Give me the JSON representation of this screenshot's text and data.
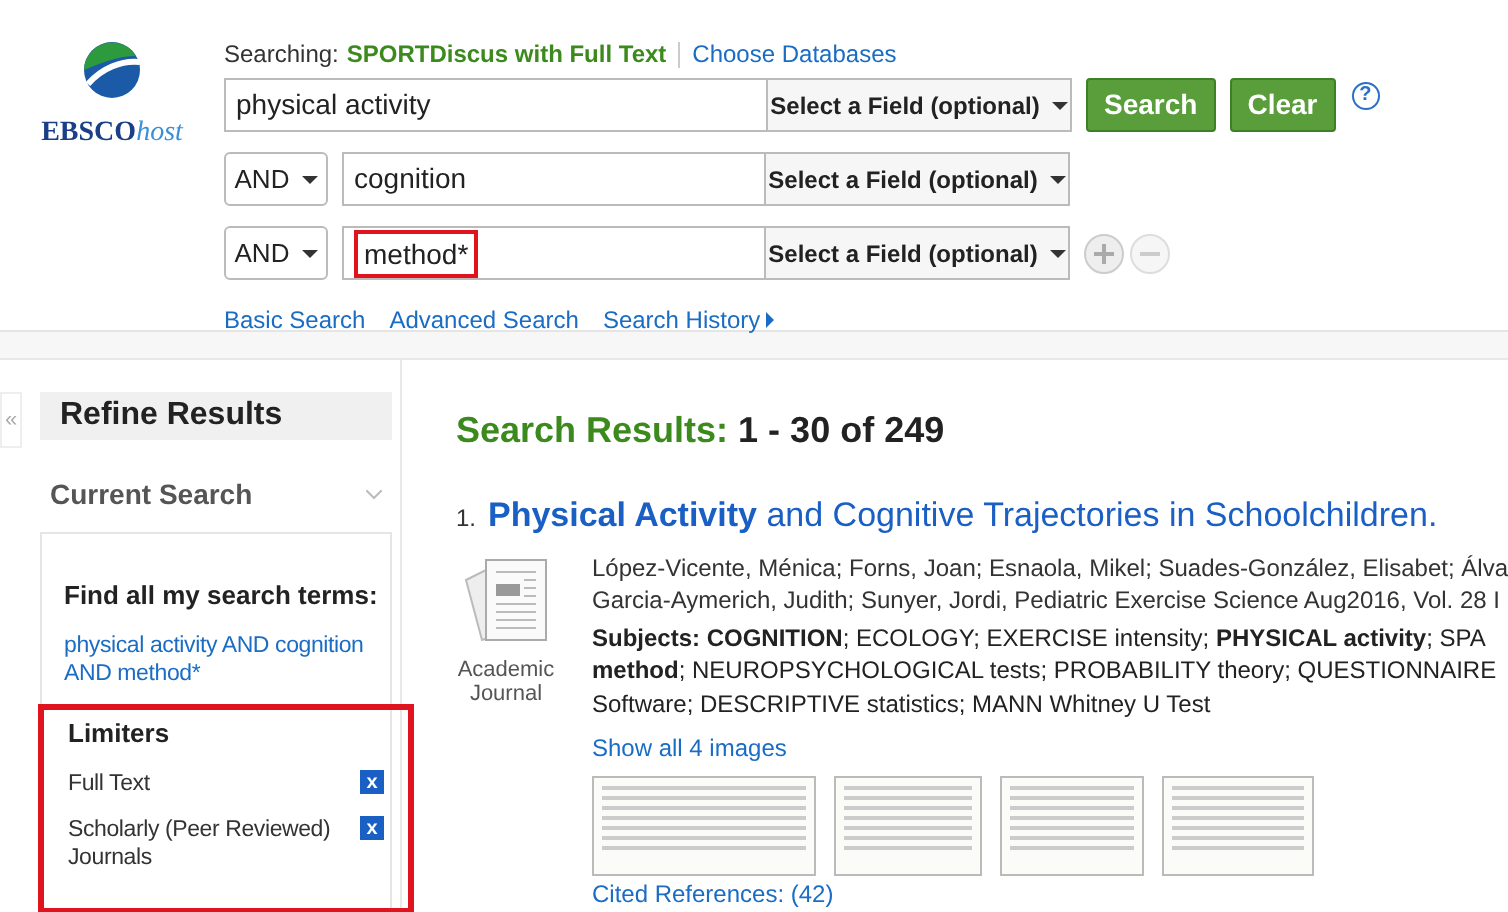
{
  "searching": {
    "label": "Searching:",
    "database": "SPORTDiscus with Full Text",
    "choose_link": "Choose Databases"
  },
  "logo": {
    "text": "EBSCO",
    "suffix": "host"
  },
  "search_rows": [
    {
      "operator": "",
      "value": "physical activity",
      "field": "Select a Field (optional)",
      "highlighted": false
    },
    {
      "operator": "AND",
      "value": "cognition",
      "field": "Select a Field (optional)",
      "highlighted": false
    },
    {
      "operator": "AND",
      "value": "method*",
      "field": "Select a Field (optional)",
      "highlighted": true
    }
  ],
  "buttons": [
    "Search",
    "Clear"
  ],
  "help": "?",
  "links": [
    "Basic Search",
    "Advanced Search",
    "Search History"
  ],
  "collapse": "«",
  "sidebar": {
    "title": "Refine Results",
    "current_search": "Current Search",
    "find_label": "Find all my search terms:",
    "query": "physical activity AND cognition AND method*",
    "limiters": {
      "title": "Limiters",
      "highlighted": true,
      "items": [
        {
          "label": "Full Text",
          "remove": "x"
        },
        {
          "label": "Scholarly (Peer Reviewed) Journals",
          "remove": "x"
        }
      ]
    }
  },
  "results": {
    "label": "Search Results:",
    "range": "1 - 30 of 249",
    "items": [
      {
        "number": "1.",
        "title": "**Physical Activity** and Cognitive Trajectories in Schoolchildren.",
        "type": "Academic Journal",
        "authors": [
          "López-Vicente, Ménica; Forns, Joan; Esnaola, Mikel; Suades-González, Elisabet; Álva",
          "Garcia-Aymerich, Judith; Sunyer, Jordi, Pediatric Exercise Science Aug2016, Vol. 28 I"
        ],
        "subjects": [
          "**Subjects: COGNITION**; ECOLOGY; EXERCISE intensity; **PHYSICAL activity**; SPA",
          "**method**; NEUROPSYCHOLOGICAL tests; PROBABILITY theory; QUESTIONNAIRE",
          "Software; DESCRIPTIVE statistics; MANN Whitney U Test"
        ],
        "images_link": "Show all 4 images",
        "cited": "Cited References: (42)"
      }
    ]
  }
}
